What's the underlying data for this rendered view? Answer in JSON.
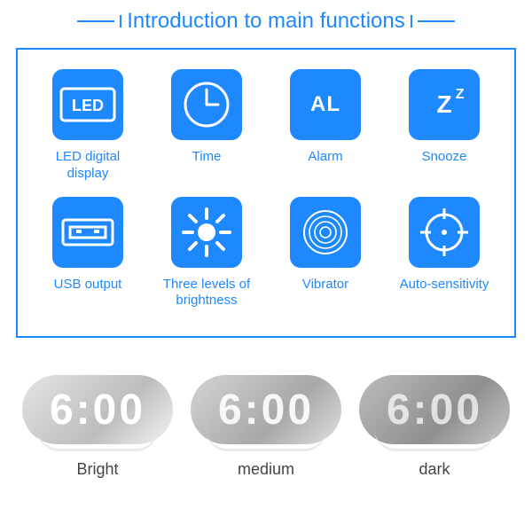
{
  "title": "Introduction to main functions",
  "features": [
    {
      "icon": "LED",
      "label": "LED digital display"
    },
    {
      "icon": "Time",
      "label": "Time"
    },
    {
      "icon": "AL",
      "label": "Alarm"
    },
    {
      "icon": "Snooze",
      "label": "Snooze"
    },
    {
      "icon": "USB",
      "label": "USB output"
    },
    {
      "icon": "Brightness",
      "label": "Three levels of brightness"
    },
    {
      "icon": "Vibrator",
      "label": "Vibrator"
    },
    {
      "icon": "AutoSens",
      "label": "Auto-sensitivity"
    }
  ],
  "clocks": [
    {
      "digits": "6:00",
      "label": "Bright"
    },
    {
      "digits": "6:00",
      "label": "medium"
    },
    {
      "digits": "6:00",
      "label": "dark"
    }
  ],
  "colors": {
    "accent": "#1e88ff"
  }
}
